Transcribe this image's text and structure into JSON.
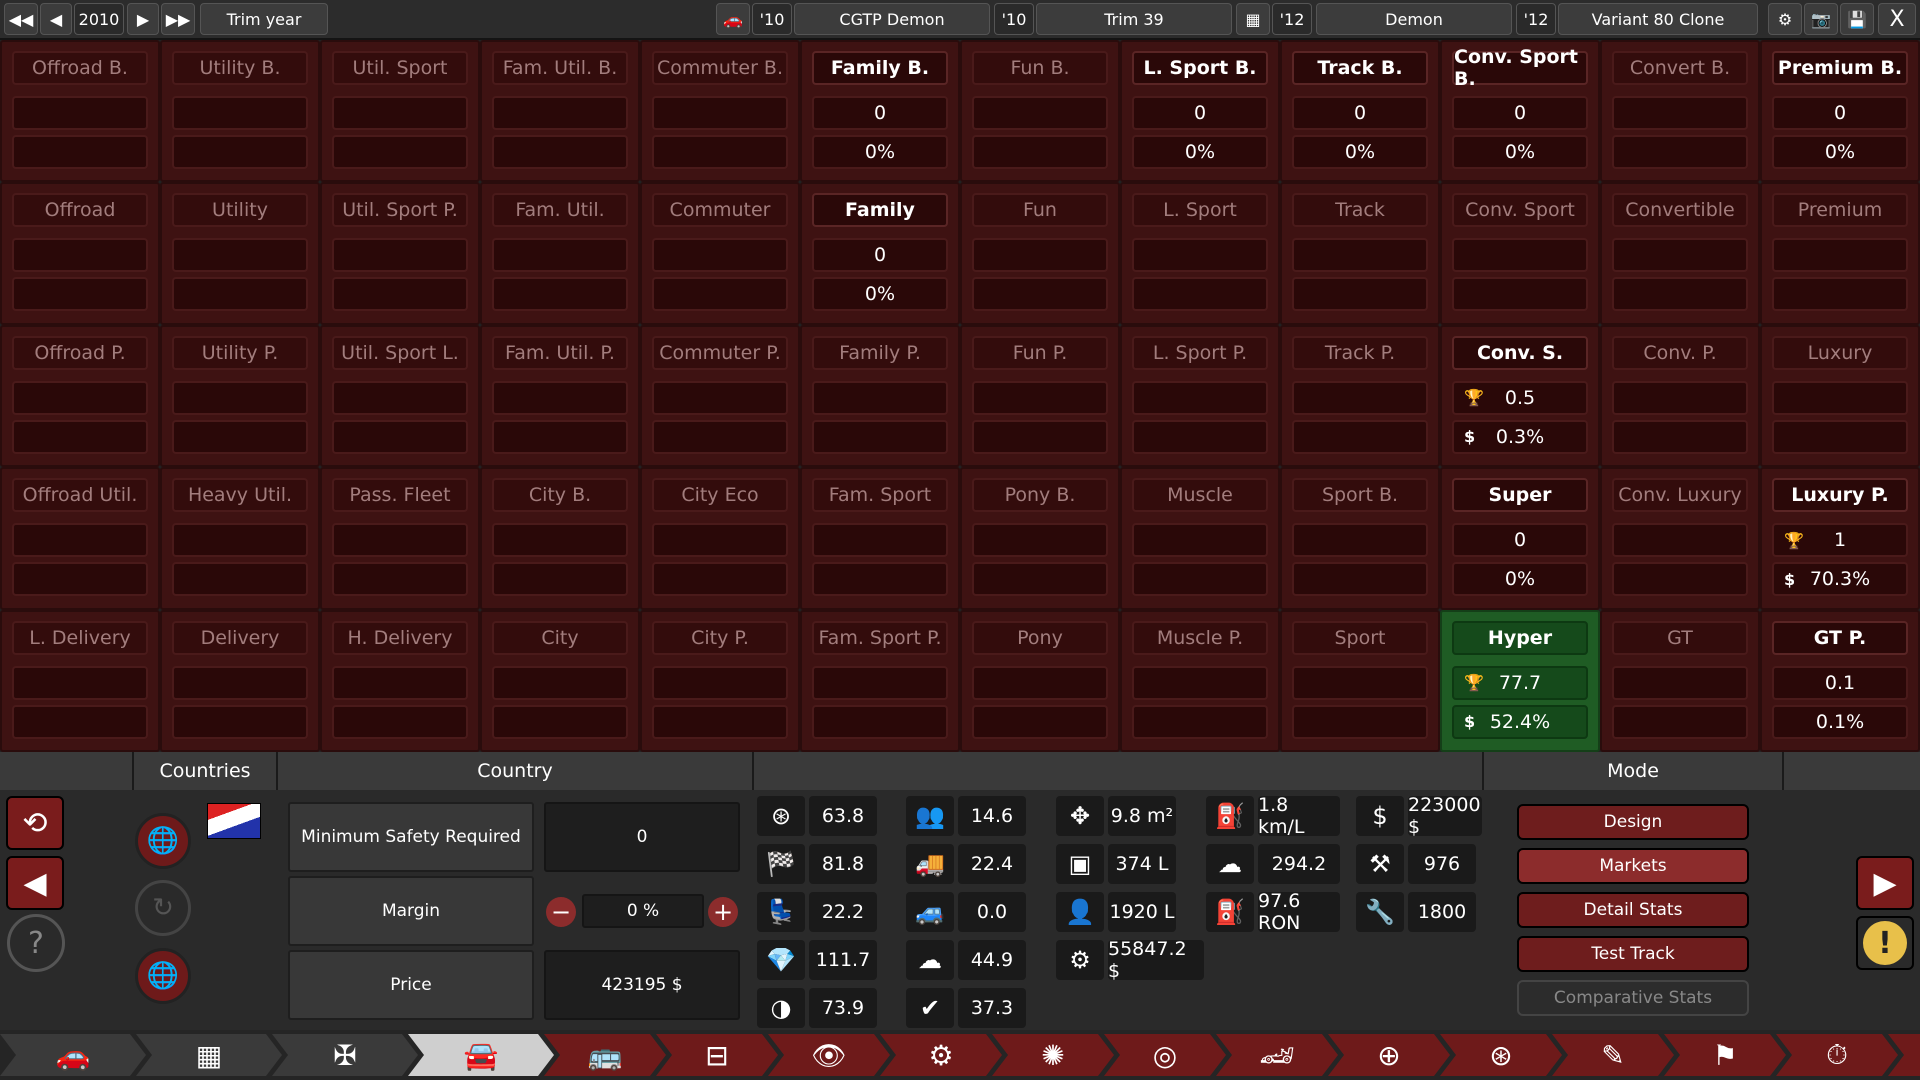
{
  "topbar": {
    "prev_fast": "◀◀",
    "prev": "◀",
    "year": "2010",
    "next": "▶",
    "next_fast": "▶▶",
    "trim_year": "Trim year",
    "car_year": "'10",
    "car_name": "CGTP Demon",
    "trim_year_short": "'10",
    "trim_name": "Trim 39",
    "engine_year": "'12",
    "engine_name": "Demon",
    "variant_year": "'12",
    "variant_name": "Variant 80 Clone",
    "close": "X"
  },
  "segments": [
    {
      "name": "Offroad B.",
      "a": "",
      "b": ""
    },
    {
      "name": "Utility B.",
      "a": "",
      "b": ""
    },
    {
      "name": "Util. Sport",
      "a": "",
      "b": ""
    },
    {
      "name": "Fam. Util. B.",
      "a": "",
      "b": ""
    },
    {
      "name": "Commuter B.",
      "a": "",
      "b": ""
    },
    {
      "name": "Family B.",
      "a": "0",
      "b": "0%"
    },
    {
      "name": "Fun B.",
      "a": "",
      "b": ""
    },
    {
      "name": "L. Sport B.",
      "a": "0",
      "b": "0%"
    },
    {
      "name": "Track B.",
      "a": "0",
      "b": "0%"
    },
    {
      "name": "Conv. Sport B.",
      "a": "0",
      "b": "0%"
    },
    {
      "name": "Convert B.",
      "a": "",
      "b": ""
    },
    {
      "name": "Premium B.",
      "a": "0",
      "b": "0%"
    },
    {
      "name": "Offroad",
      "a": "",
      "b": ""
    },
    {
      "name": "Utility",
      "a": "",
      "b": ""
    },
    {
      "name": "Util. Sport P.",
      "a": "",
      "b": ""
    },
    {
      "name": "Fam. Util.",
      "a": "",
      "b": ""
    },
    {
      "name": "Commuter",
      "a": "",
      "b": ""
    },
    {
      "name": "Family",
      "a": "0",
      "b": "0%"
    },
    {
      "name": "Fun",
      "a": "",
      "b": ""
    },
    {
      "name": "L. Sport",
      "a": "",
      "b": ""
    },
    {
      "name": "Track",
      "a": "",
      "b": ""
    },
    {
      "name": "Conv. Sport",
      "a": "",
      "b": ""
    },
    {
      "name": "Convertible",
      "a": "",
      "b": ""
    },
    {
      "name": "Premium",
      "a": "",
      "b": ""
    },
    {
      "name": "Offroad P.",
      "a": "",
      "b": ""
    },
    {
      "name": "Utility P.",
      "a": "",
      "b": ""
    },
    {
      "name": "Util. Sport L.",
      "a": "",
      "b": ""
    },
    {
      "name": "Fam. Util. P.",
      "a": "",
      "b": ""
    },
    {
      "name": "Commuter P.",
      "a": "",
      "b": ""
    },
    {
      "name": "Family P.",
      "a": "",
      "b": ""
    },
    {
      "name": "Fun P.",
      "a": "",
      "b": ""
    },
    {
      "name": "L. Sport P.",
      "a": "",
      "b": ""
    },
    {
      "name": "Track P.",
      "a": "",
      "b": ""
    },
    {
      "name": "Conv. S.",
      "a": "0.5",
      "b": "0.3%",
      "icons": true
    },
    {
      "name": "Conv. P.",
      "a": "",
      "b": ""
    },
    {
      "name": "Luxury",
      "a": "",
      "b": ""
    },
    {
      "name": "Offroad Util.",
      "a": "",
      "b": ""
    },
    {
      "name": "Heavy Util.",
      "a": "",
      "b": ""
    },
    {
      "name": "Pass. Fleet",
      "a": "",
      "b": ""
    },
    {
      "name": "City B.",
      "a": "",
      "b": ""
    },
    {
      "name": "City Eco",
      "a": "",
      "b": ""
    },
    {
      "name": "Fam. Sport",
      "a": "",
      "b": ""
    },
    {
      "name": "Pony B.",
      "a": "",
      "b": ""
    },
    {
      "name": "Muscle",
      "a": "",
      "b": ""
    },
    {
      "name": "Sport B.",
      "a": "",
      "b": ""
    },
    {
      "name": "Super",
      "a": "0",
      "b": "0%"
    },
    {
      "name": "Conv. Luxury",
      "a": "",
      "b": ""
    },
    {
      "name": "Luxury P.",
      "a": "1",
      "b": "70.3%",
      "icons": true
    },
    {
      "name": "L. Delivery",
      "a": "",
      "b": ""
    },
    {
      "name": "Delivery",
      "a": "",
      "b": ""
    },
    {
      "name": "H. Delivery",
      "a": "",
      "b": ""
    },
    {
      "name": "City",
      "a": "",
      "b": ""
    },
    {
      "name": "City P.",
      "a": "",
      "b": ""
    },
    {
      "name": "Fam. Sport P.",
      "a": "",
      "b": ""
    },
    {
      "name": "Pony",
      "a": "",
      "b": ""
    },
    {
      "name": "Muscle P.",
      "a": "",
      "b": ""
    },
    {
      "name": "Sport",
      "a": "",
      "b": ""
    },
    {
      "name": "Hyper",
      "a": "77.7",
      "b": "52.4%",
      "icons": true,
      "green": true
    },
    {
      "name": "GT",
      "a": "",
      "b": ""
    },
    {
      "name": "GT P.",
      "a": "0.1",
      "b": "0.1%"
    }
  ],
  "bottom": {
    "countries_header": "Countries",
    "country_header": "Country",
    "mode_header": "Mode",
    "min_safety_label": "Minimum Safety Required",
    "min_safety_value": "0",
    "margin_label": "Margin",
    "margin_value": "0 %",
    "price_label": "Price",
    "price_value": "423195 $",
    "stats": {
      "drivability": "63.8",
      "sportiness": "81.8",
      "comfort": "22.2",
      "prestige": "111.7",
      "safety": "73.9",
      "practicality": "14.6",
      "utility": "22.4",
      "offroad": "0.0",
      "environmental": "44.9",
      "dependability": "37.3",
      "passenger_area": "9.8 m²",
      "cargo_volume": "374 L",
      "passenger_volume": "1920 L",
      "design_cost": "55847.2 $",
      "fuel_economy": "1.8 km/L",
      "emissions": "294.2",
      "fuel_type": "97.6 RON",
      "cost": "223000 $",
      "weight": "976",
      "service": "1800"
    },
    "mode_buttons": [
      "Design",
      "Markets",
      "Detail Stats",
      "Test Track",
      "Comparative Stats"
    ]
  },
  "nav_tabs": [
    "car-tab",
    "chassis-tab",
    "suspension-tab",
    "body-tab",
    "fixtures-tab",
    "interior-tab",
    "safety-tab",
    "brakes-tab",
    "wheels-tab",
    "tires-tab",
    "aero-tab",
    "steering-tab",
    "sportiness-tab",
    "trim-tab",
    "tune-tab",
    "final-tab",
    "done-tab"
  ],
  "colors": {
    "cell_bg": "#3e1212",
    "hyper_green": "#1f5c24",
    "markets_btn": "#8c2c2c",
    "design_btn": "#6e1d1d"
  }
}
